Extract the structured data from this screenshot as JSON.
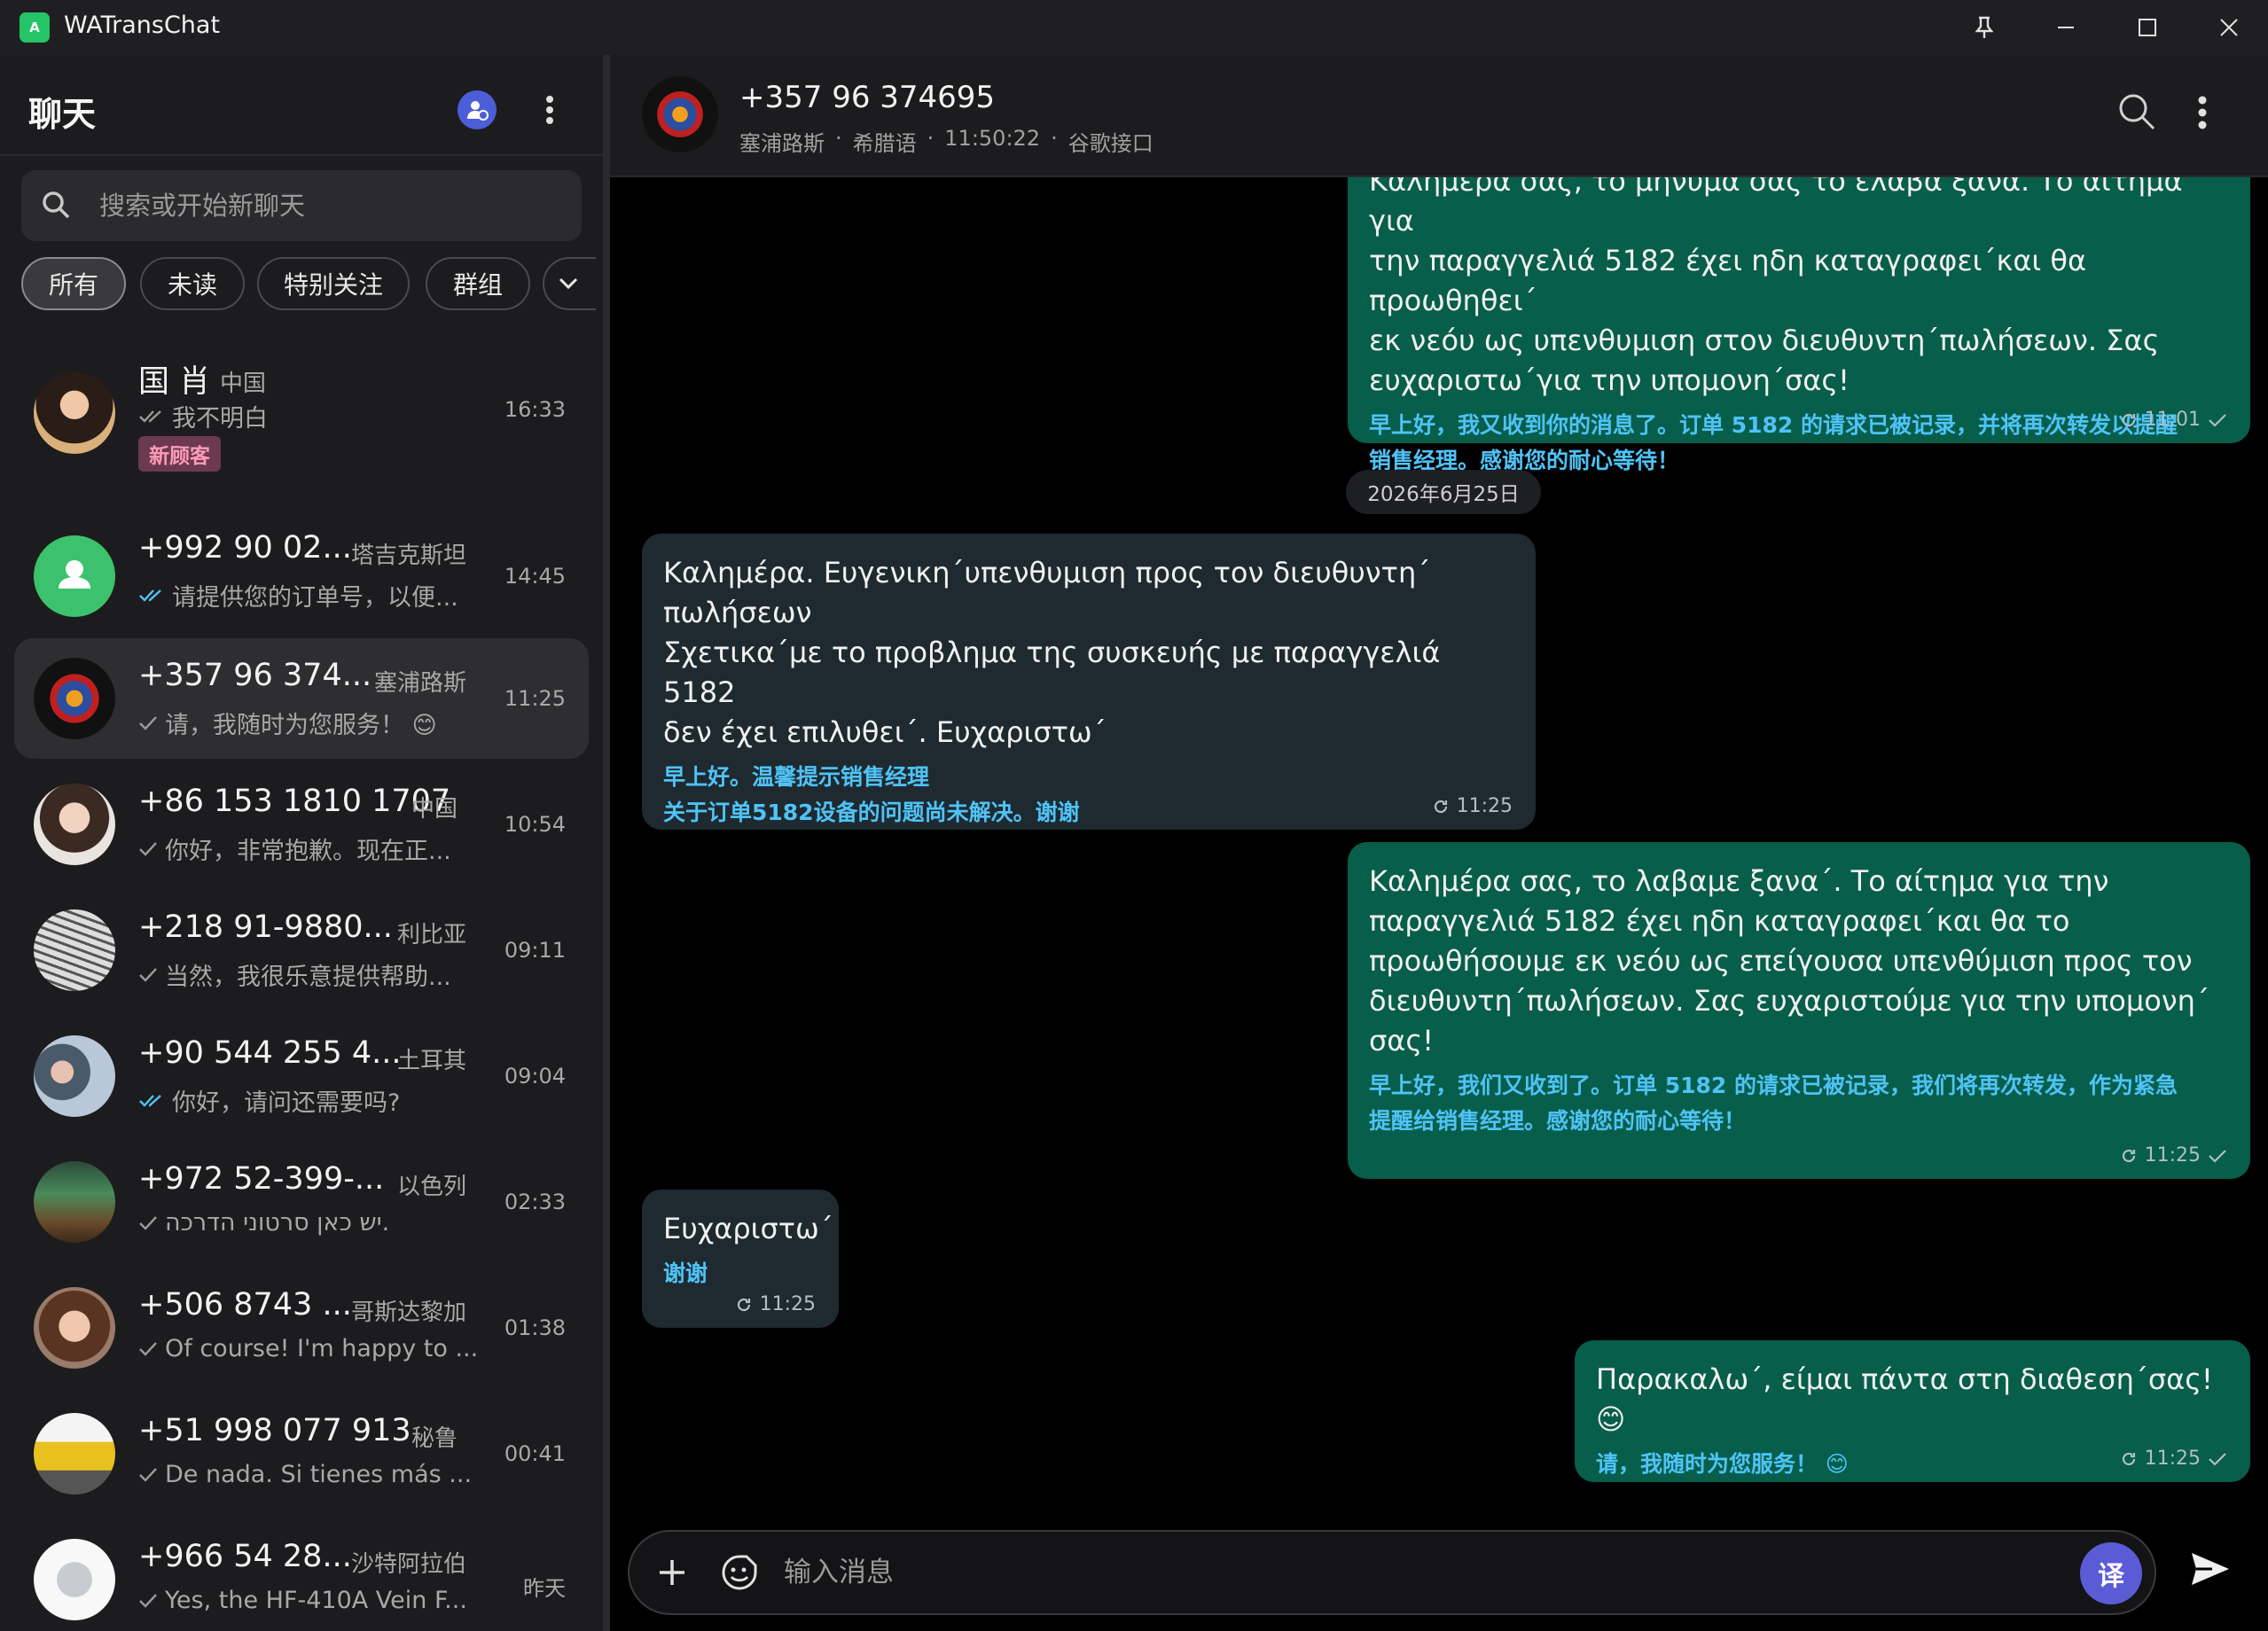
{
  "app": {
    "title": "WATransChat",
    "logo_text": "A"
  },
  "sidebar": {
    "title": "聊天",
    "search_placeholder": "搜索或开始新聊天",
    "filters": [
      "所有",
      "未读",
      "特别关注",
      "群组"
    ],
    "chats": [
      {
        "name": "国 肖",
        "country": "中国",
        "preview": "我不明白",
        "time": "16:33",
        "tag": "新顾客",
        "tick": "double-gray"
      },
      {
        "name": "+992 90 02...",
        "country": "塔吉克斯坦",
        "preview": "请提供您的订单号，以便...",
        "time": "14:45",
        "tick": "double-blue"
      },
      {
        "name": "+357 96 374...",
        "country": "塞浦路斯",
        "preview": "请，我随时为您服务！ 😊",
        "time": "11:25",
        "tick": "single"
      },
      {
        "name": "+86 153 1810 1707",
        "country": "中国",
        "preview": "你好，非常抱歉。现在正...",
        "time": "10:54",
        "tick": "single"
      },
      {
        "name": "+218 91-9880...",
        "country": "利比亚",
        "preview": "当然，我很乐意提供帮助...",
        "time": "09:11",
        "tick": "single"
      },
      {
        "name": "+90 544 255 4...",
        "country": "土耳其",
        "preview": "你好，请问还需要吗?",
        "time": "09:04",
        "tick": "double-blue"
      },
      {
        "name": "+972 52-399-...",
        "country": "以色列",
        "preview": "יש כאן סרטוני הדרכה.",
        "time": "02:33",
        "tick": "single"
      },
      {
        "name": "+506 8743 ...",
        "country": "哥斯达黎加",
        "preview": "Of course! I'm happy to ...",
        "time": "01:38",
        "tick": "single"
      },
      {
        "name": "+51 998 077 913",
        "country": "秘鲁",
        "preview": "De nada. Si tienes más ...",
        "time": "00:41",
        "tick": "single"
      },
      {
        "name": "+966 54 28...",
        "country": "沙特阿拉伯",
        "preview": "Yes, the HF-410A Vein F...",
        "time": "昨天",
        "tick": "single"
      }
    ]
  },
  "chat": {
    "name": "+357 96 374695",
    "country": "塞浦路斯",
    "language": "希腊语",
    "time": "11:50:22",
    "interface": "谷歌接口",
    "separator": "·",
    "date_divider": "2026年6月25日",
    "messages": [
      {
        "dir": "out",
        "text": "Καλημέρα σας, το μήνυμά σας το έλαβα ξανά. Το αίτημα για\nτην παραγγελιά 5182 έχει ηδη καταγραφει΄και θα προωθηθει΄\nεκ νεόυ ως υπενθυμιση στον διευθυντη΄πωλήσεων. Σας\nευχαριστω΄για την υπομονη΄σας!",
        "trans": "早上好，我又收到你的消息了。订单 5182 的请求已被记录，并将再次转发以提醒\n销售经理。感谢您的耐心等待！",
        "time": "11:01"
      },
      {
        "dir": "in",
        "text": "Καλημέρα. Ευγενικη΄υπενθυμιση προς τον διευθυντη΄\nπωλήσεων\nΣχετικα΄με το προβλημα της συσκευής με παραγγελιά 5182\nδεν έχει επιλυθει΄. Ευχαριστω΄",
        "trans": "早上好。温馨提示销售经理\n关于订单5182设备的问题尚未解决。谢谢",
        "time": "11:25"
      },
      {
        "dir": "out",
        "text": "Καλημέρα σας, το λαβαμε ξανα΄. Το αίτημα για την\nπαραγγελιά 5182 έχει ηδη καταγραφει΄και θα το\nπροωθήσουμε εκ νεόυ ως επείγουσα υπενθύμιση προς τον\nδιευθυντη΄πωλήσεων. Σας ευχαριστούμε για την υπομονη΄\nσας!",
        "trans": "早上好，我们又收到了。订单 5182 的请求已被记录，我们将再次转发，作为紧急\n提醒给销售经理。感谢您的耐心等待！",
        "time": "11:25"
      },
      {
        "dir": "in",
        "text": "Ευχαριστω΄",
        "trans": "谢谢",
        "time": "11:25"
      },
      {
        "dir": "out",
        "text": "Παρακαλω΄, είμαι πάντα στη διαθεση΄σας! 😊",
        "trans": "请，我随时为您服务！ 😊",
        "time": "11:25"
      }
    ]
  },
  "composer": {
    "placeholder": "输入消息",
    "translate_label": "译"
  },
  "colors": {
    "accent_green": "#075e4a",
    "incoming": "#1e2a30",
    "translation": "#4fc3f7",
    "brand": "#25c466"
  }
}
